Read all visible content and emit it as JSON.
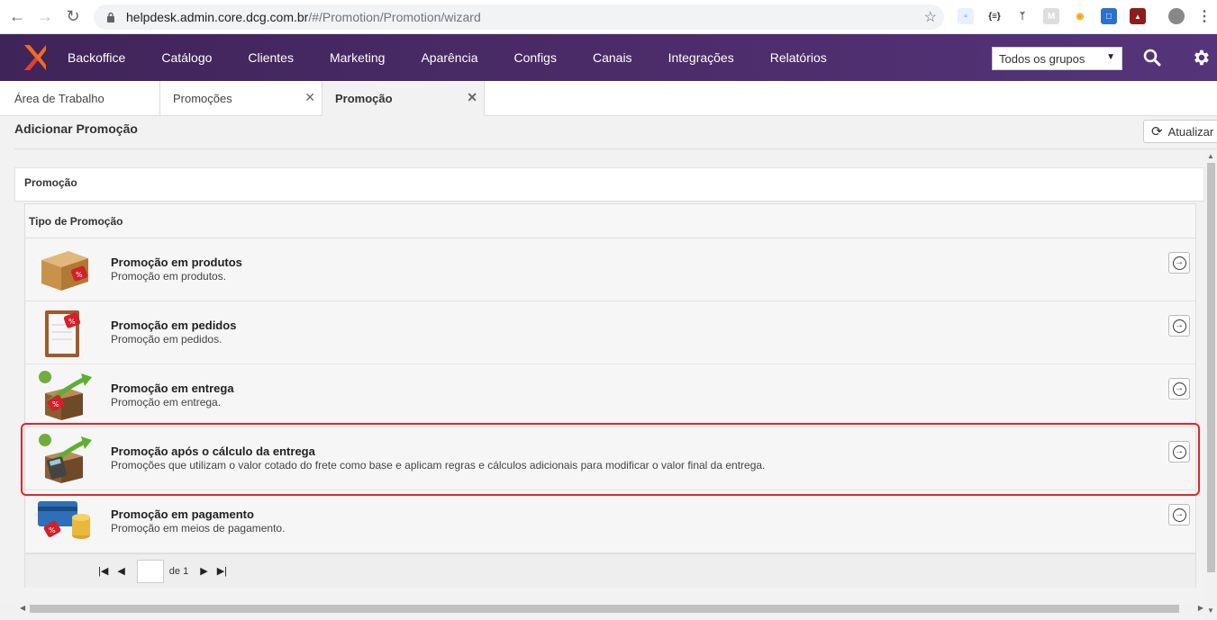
{
  "browser": {
    "url_host": "helpdesk.admin.core.dcg.com.br",
    "url_path": "/#/Promotion/Promotion/wizard"
  },
  "appbar": {
    "menu": [
      "Backoffice",
      "Catálogo",
      "Clientes",
      "Marketing",
      "Aparência",
      "Configs",
      "Canais",
      "Integrações",
      "Relatórios"
    ],
    "group_select": "Todos os grupos",
    "brand_color": "#4d2d6b"
  },
  "tabs": [
    {
      "label": "Área de Trabalho",
      "closable": false
    },
    {
      "label": "Promoções",
      "closable": true
    },
    {
      "label": "Promoção",
      "closable": true,
      "active": true
    }
  ],
  "page": {
    "title": "Adicionar Promoção",
    "refresh_label": "Atualizar"
  },
  "panel": {
    "title": "Promoção"
  },
  "grid": {
    "header": "Tipo de Promoção",
    "rows": [
      {
        "title": "Promoção em produtos",
        "desc": "Promoção em produtos.",
        "icon": "product-box-icon"
      },
      {
        "title": "Promoção em pedidos",
        "desc": "Promoção em pedidos.",
        "icon": "order-clipboard-icon"
      },
      {
        "title": "Promoção em entrega",
        "desc": "Promoção em entrega.",
        "icon": "delivery-box-icon"
      },
      {
        "title": "Promoção após o cálculo da entrega",
        "desc": "Promoções que utilizam o valor cotado do frete como base e aplicam regras e cálculos adicionais para modificar o valor final da entrega.",
        "icon": "delivery-calculator-icon",
        "highlighted": true
      },
      {
        "title": "Promoção em pagamento",
        "desc": "Promoção em meios de pagamento.",
        "icon": "payment-card-icon"
      }
    ]
  },
  "pager": {
    "of_label": "de 1"
  },
  "highlight_color": "#e0262b"
}
